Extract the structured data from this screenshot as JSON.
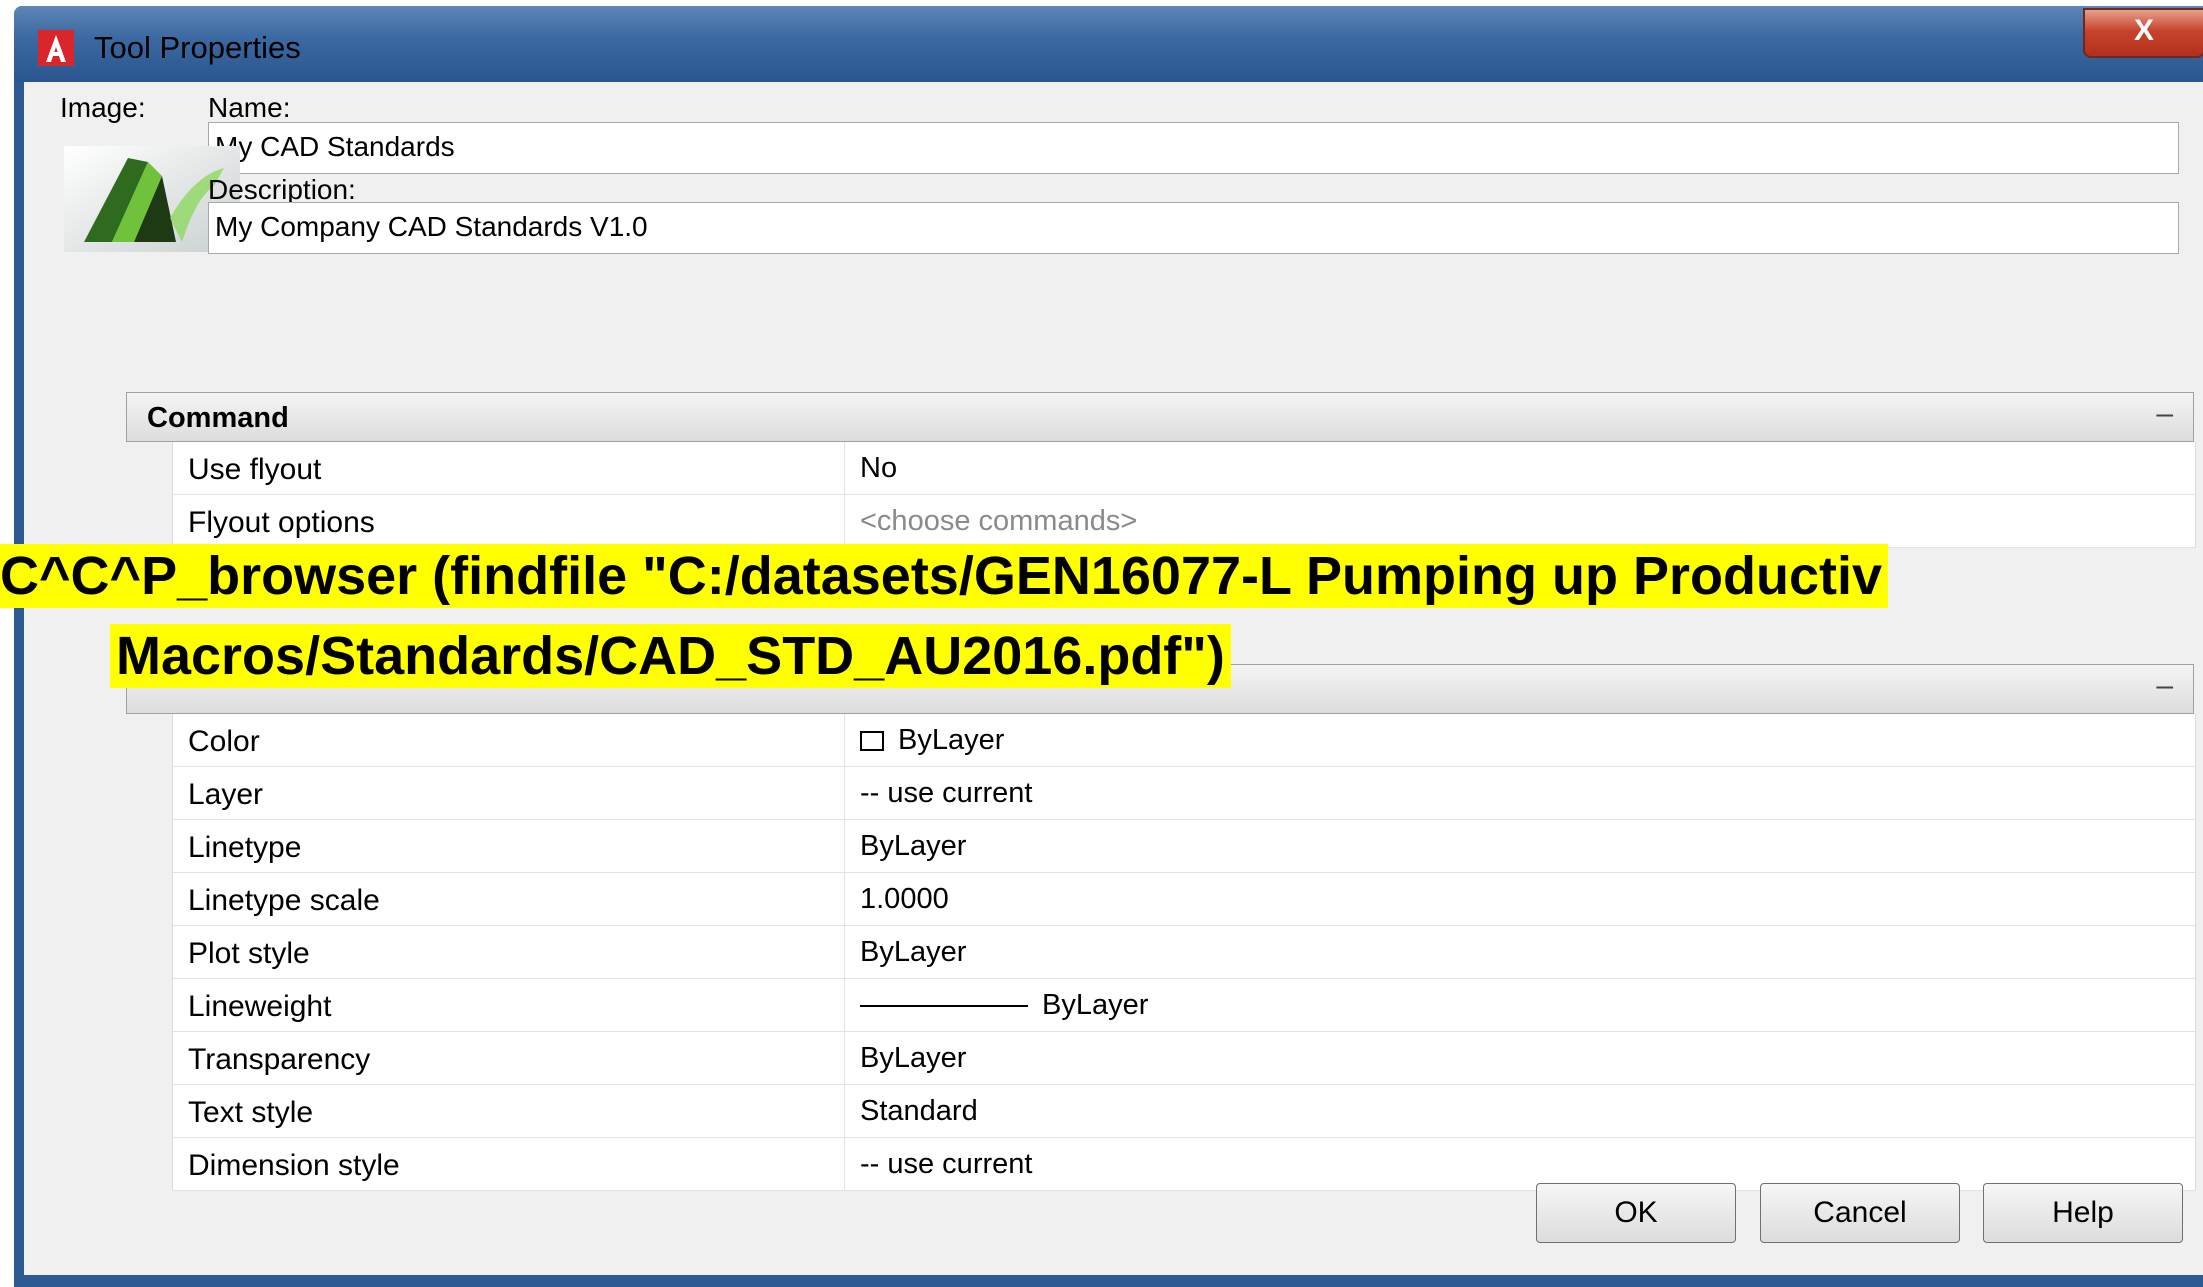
{
  "window": {
    "title": "Tool Properties",
    "close_label": "X"
  },
  "form": {
    "image_label": "Image:",
    "name_label": "Name:",
    "name_value": "My CAD Standards",
    "description_label": "Description:",
    "description_value": "My Company CAD Standards V1.0"
  },
  "sections": {
    "command": {
      "title": "Command",
      "toggle": "–",
      "rows": [
        {
          "label": "Use flyout",
          "value": "No"
        },
        {
          "label": "Flyout options",
          "value": "<choose commands>"
        }
      ]
    },
    "general": {
      "toggle": "–",
      "rows": [
        {
          "label": "Color",
          "value": "ByLayer"
        },
        {
          "label": "Layer",
          "value": "-- use current"
        },
        {
          "label": "Linetype",
          "value": "ByLayer"
        },
        {
          "label": "Linetype scale",
          "value": "1.0000"
        },
        {
          "label": "Plot style",
          "value": "ByLayer"
        },
        {
          "label": "Lineweight",
          "value": "ByLayer"
        },
        {
          "label": "Transparency",
          "value": "ByLayer"
        },
        {
          "label": "Text style",
          "value": "Standard"
        },
        {
          "label": "Dimension  style",
          "value": "-- use current"
        }
      ]
    }
  },
  "buttons": {
    "ok": "OK",
    "cancel": "Cancel",
    "help": "Help"
  },
  "overlay": {
    "line1": "C^C^P_browser (findfile \"C:/datasets/GEN16077-L Pumping up Productiv",
    "line2": "Macros/Standards/CAD_STD_AU2016.pdf\")"
  },
  "colors": {
    "titlebar": "#3d6aa2",
    "close": "#c8432c",
    "highlight": "#ffff00",
    "app_icon": "#d9262b"
  }
}
